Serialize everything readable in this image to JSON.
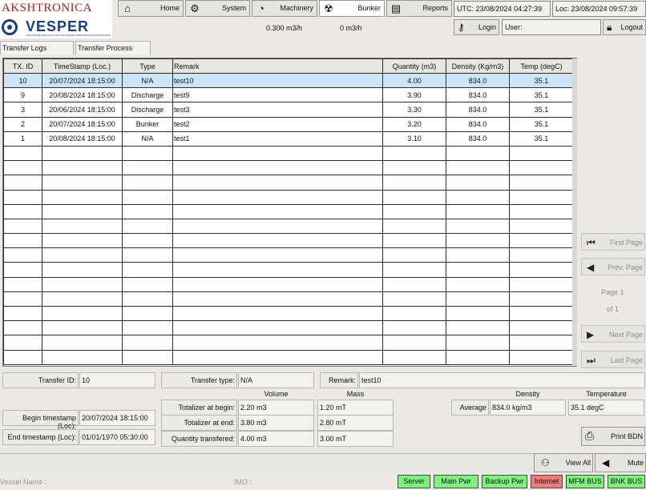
{
  "brand": {
    "company": "AKSHTRONICA",
    "product": "VESPER",
    "tagline": "THE INTEGRATED SOLUTION FOR VESSEL PERFORMANCE MONITORING"
  },
  "nav": [
    {
      "label": "Home",
      "icon": "home-icon"
    },
    {
      "label": "System",
      "icon": "gear-icon"
    },
    {
      "label": "Machinery",
      "icon": "gauge-icon"
    },
    {
      "label": "Bunker",
      "icon": "radiation-icon"
    },
    {
      "label": "Reports",
      "icon": "report-icon"
    }
  ],
  "utc_time": "UTC: 23/08/2024 04:27:39",
  "loc_time": "Loc: 23/08/2024 09:57:39",
  "flow_rate_1": "0.300 m3/h",
  "flow_rate_2": "0 m3/h",
  "login_label": "Login",
  "user_label": "User:",
  "logout_label": "Logout",
  "tabs": [
    "Transfer Logs",
    "Transfer Process"
  ],
  "table": {
    "headers": [
      "TX. ID",
      "TimeStamp (Loc.)",
      "Type",
      "Remark",
      "Quantity (m3)",
      "Density (Kg/m3)",
      "Temp (degC)"
    ],
    "rows": [
      [
        "10",
        "20/07/2024 18:15:00",
        "N/A",
        "test10",
        "4.00",
        "834.0",
        "35.1"
      ],
      [
        "9",
        "20/08/2024 18:15:00",
        "Discharge",
        "test9",
        "3.90",
        "834.0",
        "35.1"
      ],
      [
        "3",
        "20/06/2024 18:15:00",
        "Discharge",
        "test3",
        "3.30",
        "834.0",
        "35.1"
      ],
      [
        "2",
        "20/07/2024 18:15:00",
        "Bunker",
        "test2",
        "3.20",
        "834.0",
        "35.1"
      ],
      [
        "1",
        "20/08/2024 18:15:00",
        "N/A",
        "test1",
        "3.10",
        "834.0",
        "35.1"
      ]
    ],
    "selected_row": 0
  },
  "pager": {
    "first": "First Page",
    "prev": "Prev. Page",
    "page_line": "Page 1",
    "of_line": "of 1",
    "next": "Next Page",
    "last": "Last Page"
  },
  "detail": {
    "transfer_id_label": "Transfer ID:",
    "transfer_id": "10",
    "transfer_type_label": "Transfer type:",
    "transfer_type": "N/A",
    "remark_label": "Remark:",
    "remark": "test10",
    "volume_hdr": "Volume",
    "mass_hdr": "Mass",
    "density_hdr": "Density",
    "temperature_hdr": "Temperature",
    "totalizer_begin_label": "Totalizer at begin:",
    "totalizer_begin_volume": "2.20 m3",
    "totalizer_begin_mass": "1.20 mT",
    "totalizer_end_label": "Totalizer at end:",
    "totalizer_end_volume": "3.80 m3",
    "totalizer_end_mass": "2.80 mT",
    "qty_label": "Quantity transfered:",
    "qty_volume": "4.00 m3",
    "qty_mass": "3.00 mT",
    "average_label": "Average",
    "average_density": "834.0 kg/m3",
    "average_temp": "35.1 degC",
    "begin_ts_label": "Begin timestamp (Loc):",
    "begin_ts": "20/07/2024 18:15:00",
    "end_ts_label": "End timestamp (Loc):",
    "end_ts": "01/01/1970 05:30:00"
  },
  "print_bdn": "Print BDN",
  "view_all": "View All",
  "mute": "Mute",
  "vessel_name_label": "Vessel Name :",
  "imo_label": "IMO :",
  "indicators": [
    {
      "label": "Server",
      "color": "#7ef27e"
    },
    {
      "label": "Main Pwr",
      "color": "#7ef27e"
    },
    {
      "label": "Backup Pwr",
      "color": "#7ef27e"
    },
    {
      "label": "Internet",
      "color": "#f27a7a"
    },
    {
      "label": "MFM BUS",
      "color": "#7ef27e"
    },
    {
      "label": "BNK BUS",
      "color": "#7ef27e"
    }
  ]
}
